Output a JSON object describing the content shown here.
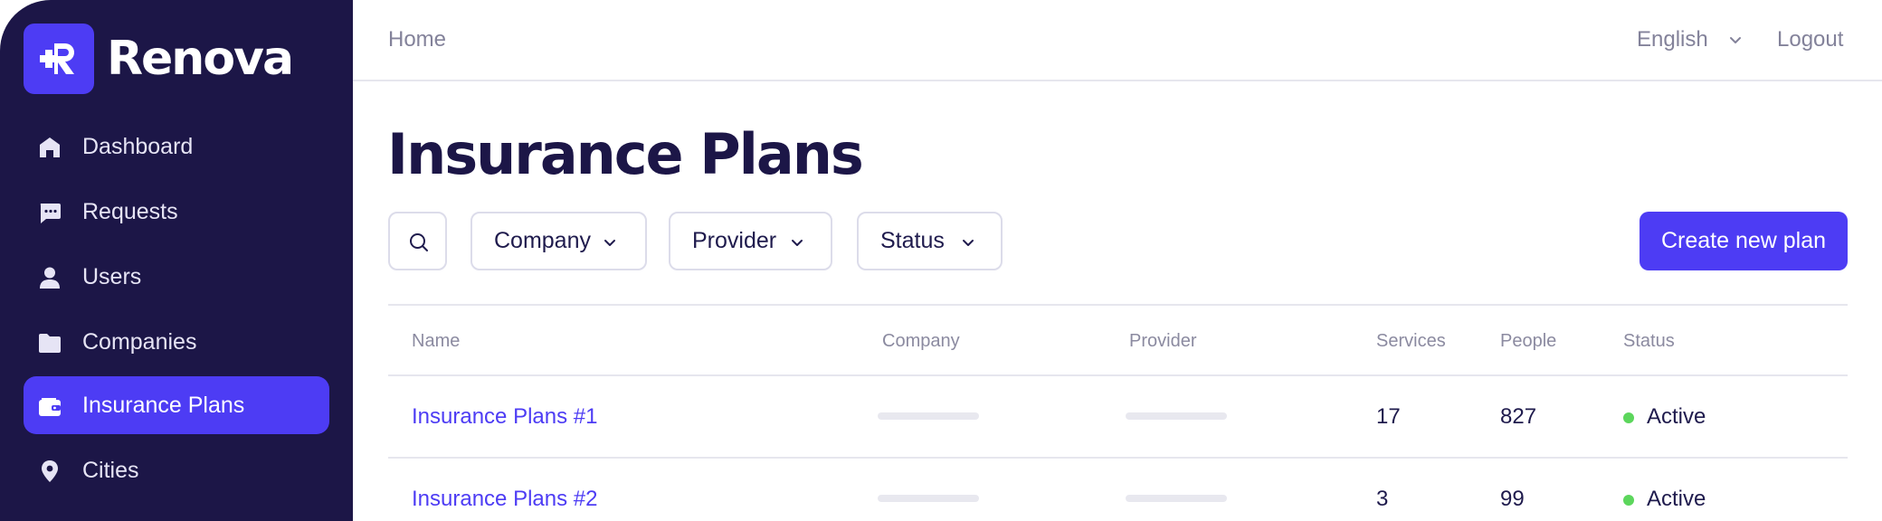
{
  "brand": {
    "name": "Renova",
    "accent": "#4d3cf4",
    "sidebar_bg": "#1c1647"
  },
  "sidebar": {
    "items": [
      {
        "label": "Dashboard",
        "icon": "home-icon"
      },
      {
        "label": "Requests",
        "icon": "chat-bubble-icon"
      },
      {
        "label": "Users",
        "icon": "user-icon"
      },
      {
        "label": "Companies",
        "icon": "folder-icon"
      },
      {
        "label": "Insurance Plans",
        "icon": "wallet-icon",
        "active": true
      },
      {
        "label": "Cities",
        "icon": "map-pin-icon"
      }
    ]
  },
  "topbar": {
    "home_label": "Home",
    "language": "English",
    "logout_label": "Logout"
  },
  "page": {
    "title": "Insurance Plans"
  },
  "filters": {
    "search_icon": "search-icon",
    "company_label": "Company",
    "provider_label": "Provider",
    "status_label": "Status",
    "create_label": "Create new plan"
  },
  "table": {
    "columns": [
      "Name",
      "Company",
      "Provider",
      "Services",
      "People",
      "Status"
    ],
    "rows": [
      {
        "name": "Insurance Plans #1",
        "services": "17",
        "people": "827",
        "status": "Active",
        "status_color": "#5cd65c"
      },
      {
        "name": "Insurance Plans #2",
        "services": "3",
        "people": "99",
        "status": "Active",
        "status_color": "#5cd65c"
      }
    ]
  }
}
